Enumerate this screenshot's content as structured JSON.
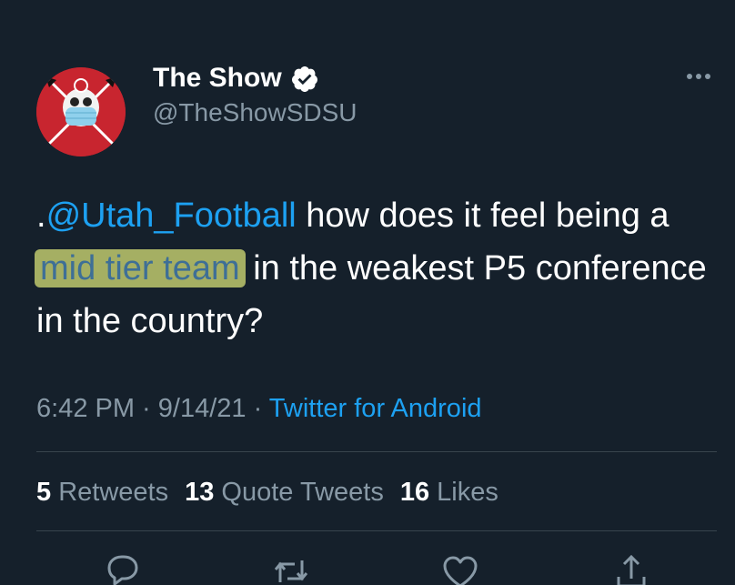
{
  "author": {
    "display_name": "The Show",
    "handle": "@TheShowSDSU",
    "verified": true,
    "avatar_color": "#c8252f"
  },
  "tweet": {
    "prefix": ".",
    "mention": "@Utah_Football",
    "text_part1": " how does it feel being a",
    "highlighted": "mid tier team",
    "text_part2": "in the weakest P5 conference in the country?"
  },
  "meta": {
    "time": "6:42 PM",
    "separator1": " · ",
    "date": "9/14/21",
    "separator2": " · ",
    "source": "Twitter for Android"
  },
  "stats": {
    "retweets_count": "5",
    "retweets_label": "Retweets",
    "quotes_count": "13",
    "quotes_label": "Quote Tweets",
    "likes_count": "16",
    "likes_label": "Likes"
  },
  "colors": {
    "background": "#15202b",
    "accent": "#1da1f2",
    "secondary_text": "#8899a6",
    "highlight": "#dee678"
  },
  "icons": [
    "verified-badge-icon",
    "more-options-icon",
    "reply-icon",
    "retweet-icon",
    "like-icon",
    "share-icon"
  ]
}
